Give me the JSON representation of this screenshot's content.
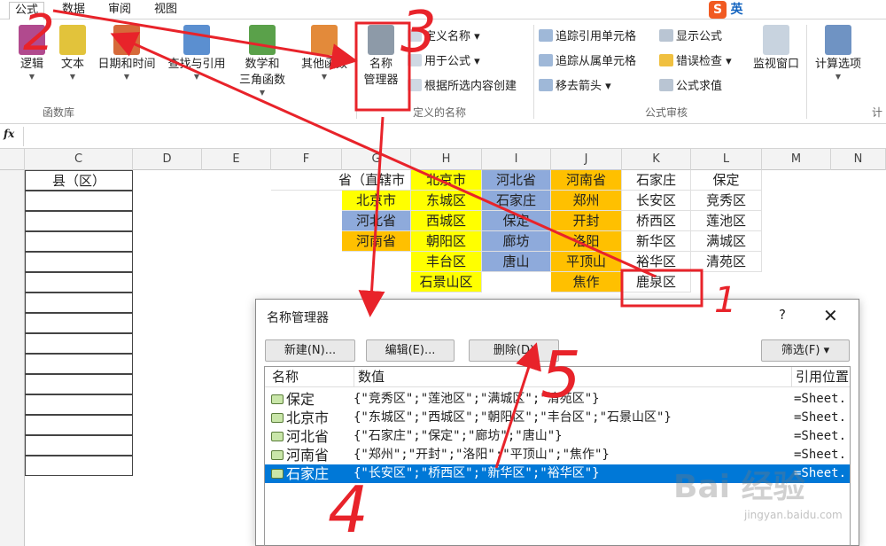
{
  "tabs": [
    "公式",
    "数据",
    "审阅",
    "视图"
  ],
  "ime": {
    "label": "英"
  },
  "ribbon": {
    "function_library": {
      "group_label": "函数库",
      "buttons": [
        "逻辑",
        "文本",
        "日期和时间",
        "查找与引用",
        "数学和",
        "三角函数",
        "其他函数"
      ]
    },
    "defined_names": {
      "group_label": "定义的名称",
      "name_manager": [
        "名称",
        "管理器"
      ],
      "define_name": "定义名称",
      "use_in_formula": "用于公式",
      "create_from_selection": "根据所选内容创建"
    },
    "formula_auditing": {
      "group_label": "公式审核",
      "trace_precedents": "追踪引用单元格",
      "trace_dependents": "追踪从属单元格",
      "remove_arrows": "移去箭头",
      "show_formulas": "显示公式",
      "error_checking": "错误检查",
      "evaluate_formula": "公式求值",
      "watch_window": "监视窗口"
    },
    "calculation": {
      "group_label": "计",
      "options": "计算选项"
    }
  },
  "formula_bar": {
    "fx_label": "fx",
    "value": ""
  },
  "columns": [
    "C",
    "D",
    "E",
    "F",
    "G",
    "H",
    "I",
    "J",
    "K",
    "L",
    "M",
    "N"
  ],
  "cells": {
    "c_header": "县（区）",
    "f_header": "省（直辖市",
    "g_col": [
      "北京市",
      "河北省",
      "河南省"
    ],
    "h_col": [
      "北京市",
      "东城区",
      "西城区",
      "朝阳区",
      "丰台区",
      "石景山区"
    ],
    "i_col": [
      "河北省",
      "石家庄",
      "保定",
      "廊坊",
      "唐山"
    ],
    "j_col": [
      "河南省",
      "郑州",
      "开封",
      "洛阳",
      "平顶山",
      "焦作"
    ],
    "k_col": [
      "石家庄",
      "长安区",
      "桥西区",
      "新华区",
      "裕华区",
      "鹿泉区"
    ],
    "l_col": [
      "保定",
      "竞秀区",
      "莲池区",
      "满城区",
      "清苑区"
    ]
  },
  "dialog": {
    "title": "名称管理器",
    "help": "?",
    "close": "✕",
    "buttons": {
      "new": "新建(N)...",
      "edit": "编辑(E)...",
      "delete": "删除(D)",
      "filter": "筛选(F) ▾"
    },
    "columns": {
      "name": "名称",
      "value": "数值",
      "refers_to": "引用位置"
    },
    "rows": [
      {
        "name": "保定",
        "value": "{\"竞秀区\";\"莲池区\";\"满城区\";\"清苑区\"}",
        "ref": "=Sheet."
      },
      {
        "name": "北京市",
        "value": "{\"东城区\";\"西城区\";\"朝阳区\";\"丰台区\";\"石景山区\"}",
        "ref": "=Sheet."
      },
      {
        "name": "河北省",
        "value": "{\"石家庄\";\"保定\";\"廊坊\";\"唐山\"}",
        "ref": "=Sheet."
      },
      {
        "name": "河南省",
        "value": "{\"郑州\";\"开封\";\"洛阳\";\"平顶山\";\"焦作\"}",
        "ref": "=Sheet."
      },
      {
        "name": "石家庄",
        "value": "{\"长安区\";\"桥西区\";\"新华区\";\"裕华区\"}",
        "ref": "=Sheet."
      }
    ],
    "selected_row": 4
  },
  "annotations": {
    "n1": "1",
    "n2": "2",
    "n3": "3",
    "n4": "4",
    "n5": "5",
    "color": "#e8232a"
  },
  "watermark": {
    "logo": "Bai 经验",
    "url": "jingyan.baidu.com"
  }
}
